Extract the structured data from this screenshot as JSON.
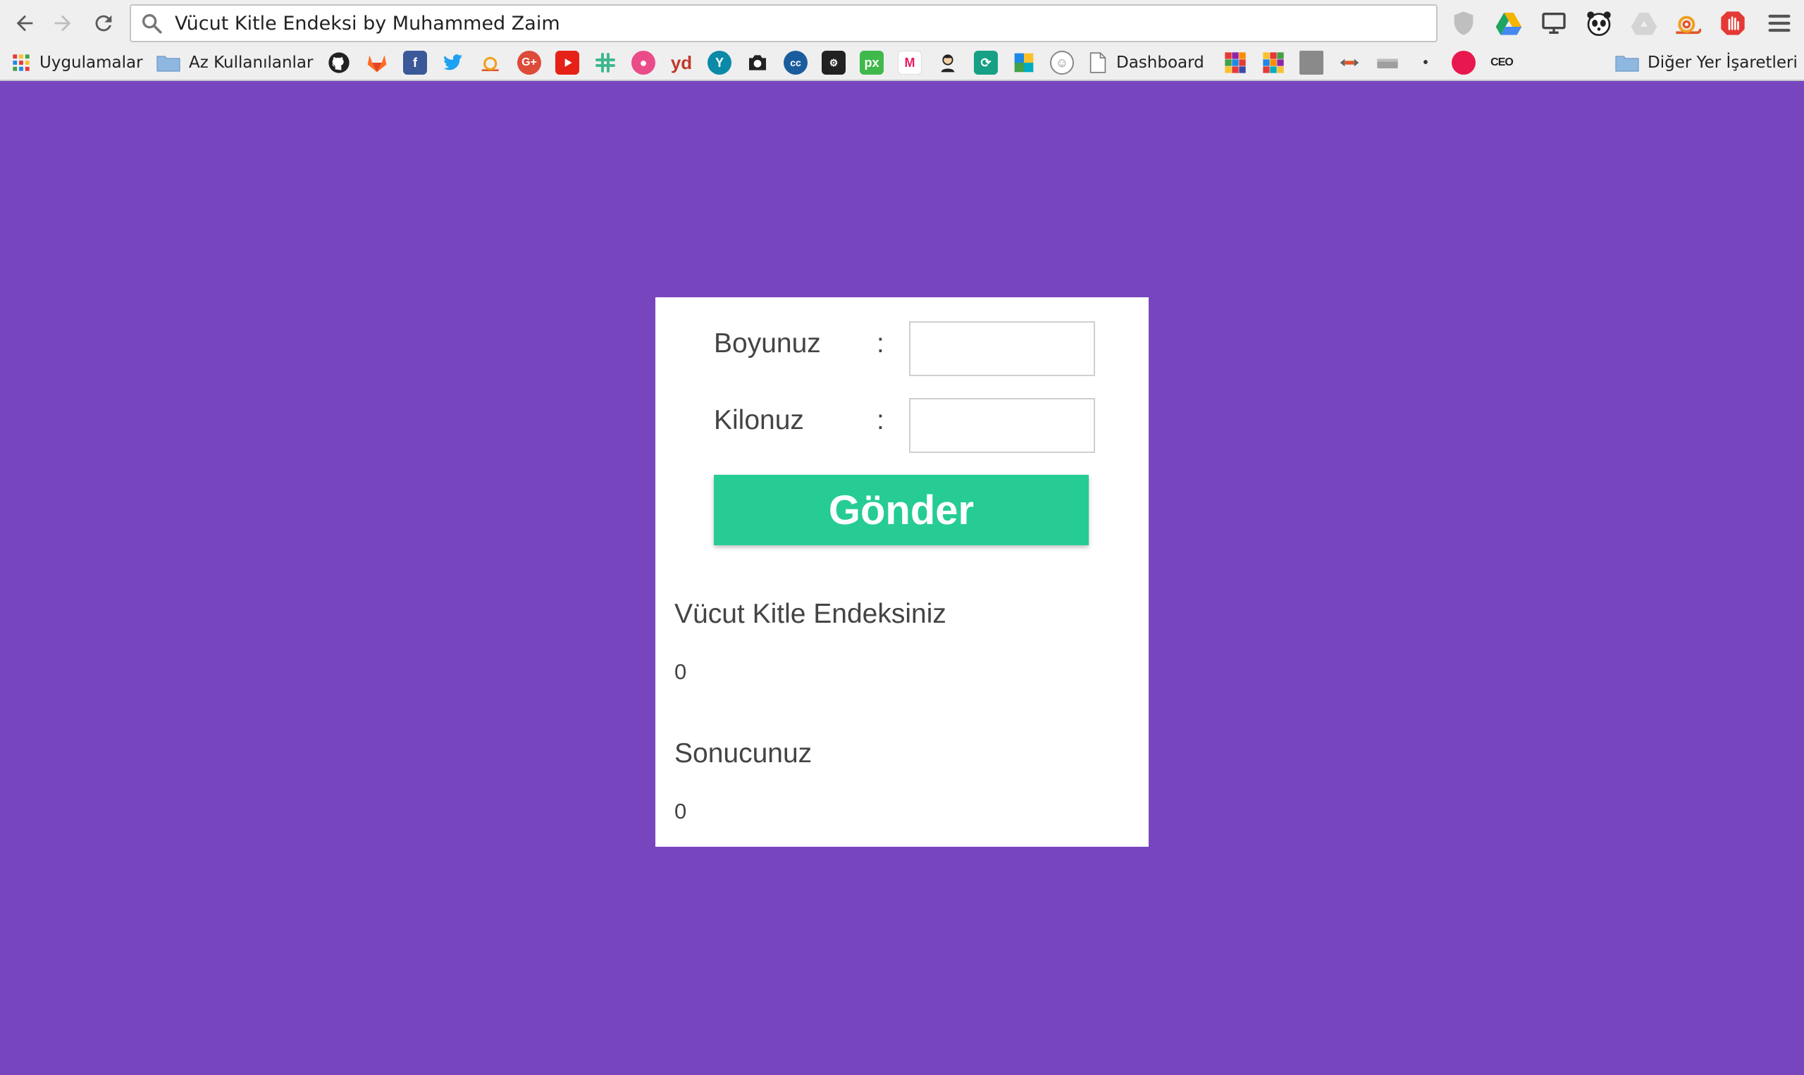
{
  "browser": {
    "address_bar_text": "Vücut Kitle Endeksi by Muhammed Zaim",
    "bookmarks": {
      "apps_label": "Uygulamalar",
      "folder_1_label": "Az Kullanılanlar",
      "dashboard_label": "Dashboard",
      "other_bookmarks_label": "Diğer Yer İşaretleri",
      "ceo_label": "CEO"
    },
    "icons": {
      "back": "back-arrow-icon",
      "forward": "forward-arrow-icon",
      "reload": "reload-icon",
      "search": "search-icon",
      "menu": "hamburger-menu-icon"
    }
  },
  "form": {
    "height_label": "Boyunuz",
    "weight_label": "Kilonuz",
    "colon": ":",
    "height_value": "",
    "weight_value": "",
    "submit_label": "Gönder"
  },
  "results": {
    "bmi_title": "Vücut Kitle Endeksiniz",
    "bmi_value": "0",
    "result_title": "Sonucunuz",
    "result_value": "0"
  },
  "colors": {
    "page_background": "#7746bf",
    "button": "#26cc94",
    "card": "#ffffff"
  }
}
